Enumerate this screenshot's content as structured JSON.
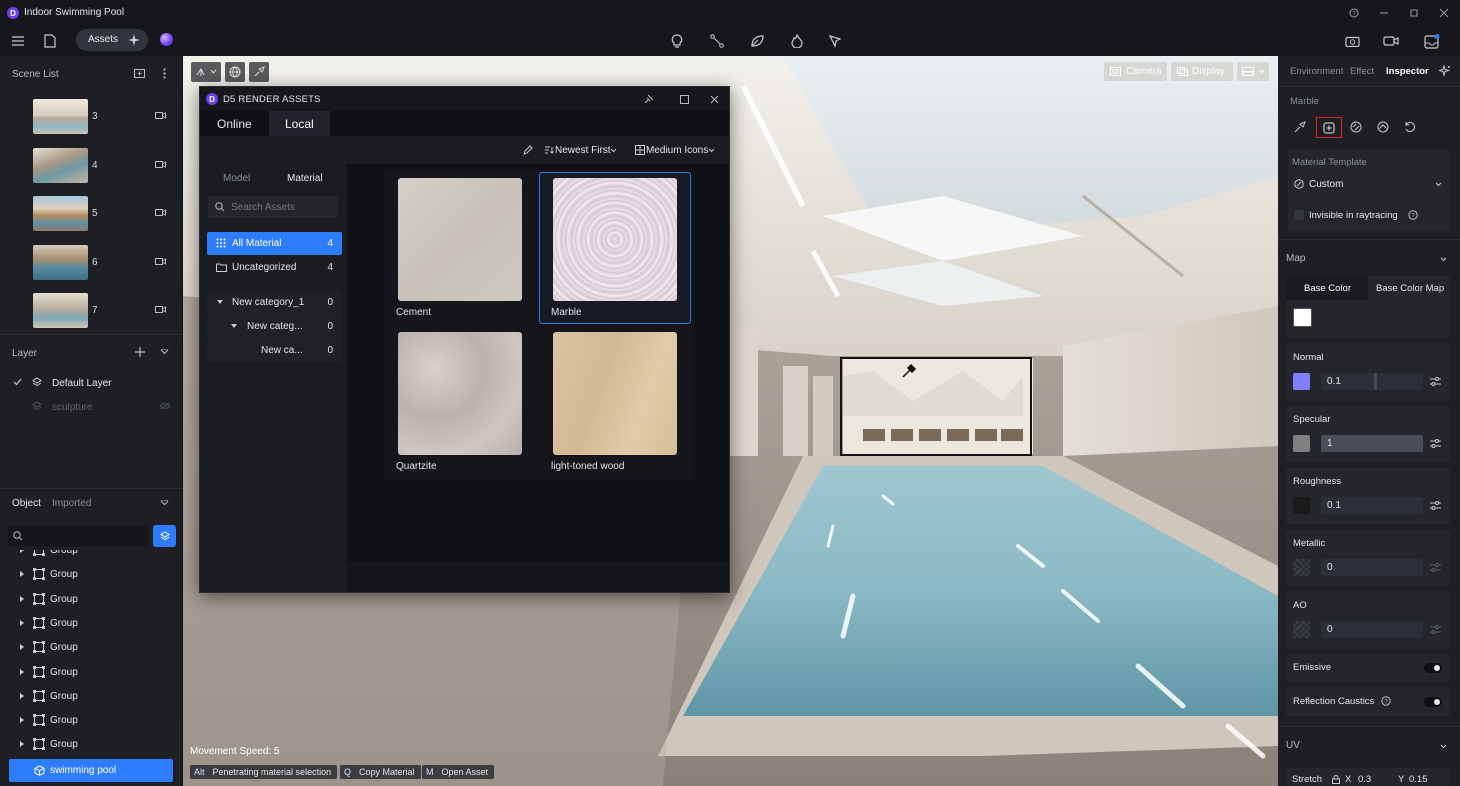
{
  "window": {
    "title": "Indoor Swimming Pool"
  },
  "toolbar": {
    "assets_label": "Assets"
  },
  "scene_list": {
    "title": "Scene List",
    "scenes": [
      {
        "label": "3"
      },
      {
        "label": "4"
      },
      {
        "label": "5"
      },
      {
        "label": "6"
      },
      {
        "label": "7"
      }
    ]
  },
  "layer": {
    "title": "Layer",
    "items": [
      {
        "label": "Default Layer",
        "active": true
      },
      {
        "label": "sculpture",
        "active": false
      }
    ]
  },
  "object_panel": {
    "tab_object": "Object",
    "tab_imported": "Imported",
    "search_placeholder": "",
    "items": [
      {
        "label": "Group"
      },
      {
        "label": "Group"
      },
      {
        "label": "Group"
      },
      {
        "label": "Group"
      },
      {
        "label": "Group"
      },
      {
        "label": "Group"
      },
      {
        "label": "Group"
      },
      {
        "label": "Group"
      },
      {
        "label": "Group"
      }
    ],
    "selected": {
      "label": "swimming pool"
    }
  },
  "viewport": {
    "camera_label": "Camera",
    "display_label": "Display",
    "movement_speed": "Movement Speed: 5",
    "hints": [
      {
        "key": "Alt",
        "label": "Penetrating material selection"
      },
      {
        "key": "Q",
        "label": "Copy Material"
      },
      {
        "key": "M",
        "label": "Open Asset"
      }
    ]
  },
  "assets_window": {
    "title": "D5 RENDER ASSETS",
    "tabs": {
      "online": "Online",
      "local": "Local"
    },
    "sort_label": "Newest First",
    "view_label": "Medium Icons",
    "sub_tabs": {
      "model": "Model",
      "material": "Material"
    },
    "search_placeholder": "Search Assets",
    "categories": [
      {
        "label": "All Material",
        "count": "4"
      },
      {
        "label": "Uncategorized",
        "count": "4"
      },
      {
        "label": "New category_1",
        "count": "0"
      },
      {
        "label": "New categ...",
        "count": "0"
      },
      {
        "label": "New ca...",
        "count": "0"
      }
    ],
    "materials": [
      {
        "name": "Cement",
        "selected": false
      },
      {
        "name": "Marble",
        "selected": true
      },
      {
        "name": "Quartzite",
        "selected": false
      },
      {
        "name": "light-toned wood",
        "selected": false
      }
    ]
  },
  "inspector": {
    "tabs": {
      "environment": "Environment",
      "effect": "Effect",
      "inspector": "Inspector"
    },
    "material_name": "Marble",
    "template_label": "Material Template",
    "template_value": "Custom",
    "invisible_label": "Invisible in raytracing",
    "map_title": "Map",
    "base_color_tab": "Base Color",
    "base_color_map_tab": "Base Color Map",
    "base_color_hex": "#ffffff",
    "normal": {
      "label": "Normal",
      "value": "0.1",
      "color": "#7f7fff"
    },
    "specular": {
      "label": "Specular",
      "value": "1",
      "color": "#808080"
    },
    "roughness": {
      "label": "Roughness",
      "value": "0.1",
      "color": "#1a1a1a"
    },
    "metallic": {
      "label": "Metallic",
      "value": "0"
    },
    "ao": {
      "label": "AO",
      "value": "0"
    },
    "emissive_label": "Emissive",
    "caustics_label": "Reflection Caustics",
    "uv_title": "UV",
    "stretch_label": "Stretch",
    "stretch_x_label": "X",
    "stretch_x": "0.3",
    "stretch_y_label": "Y",
    "stretch_y": "0.15"
  }
}
